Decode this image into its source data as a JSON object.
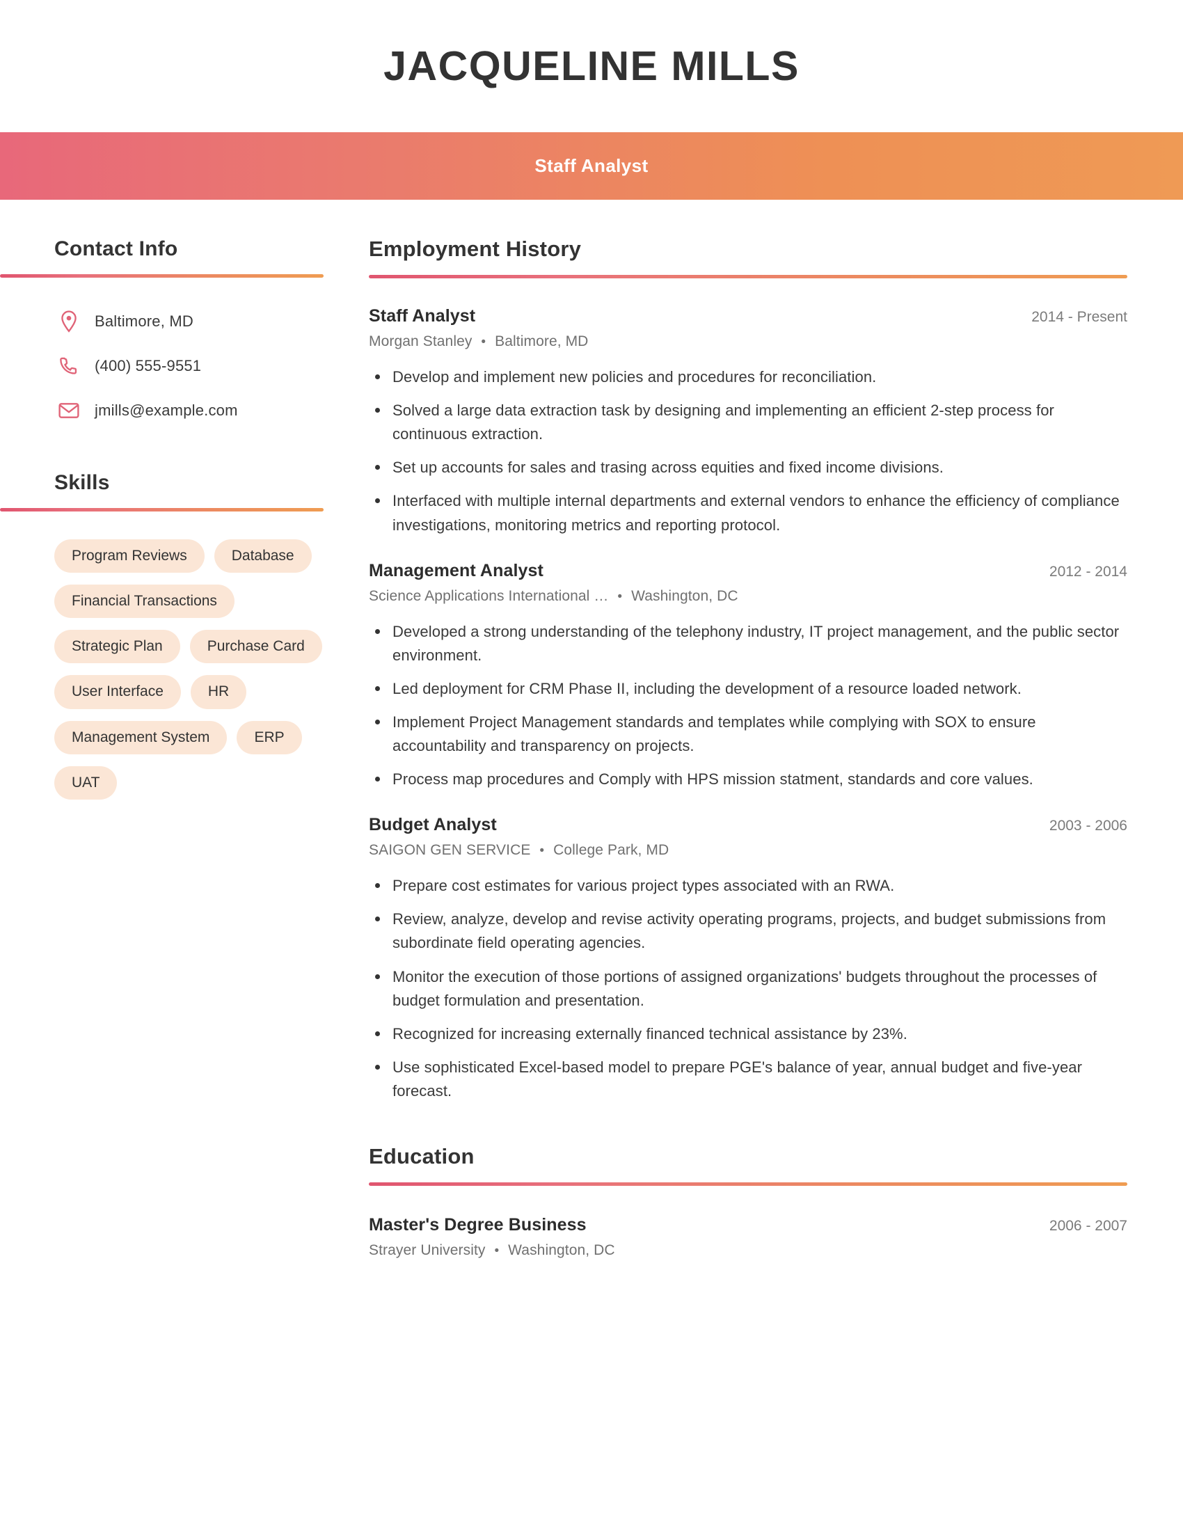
{
  "header": {
    "full_name": "JACQUELINE MILLS",
    "job_title": "Staff Analyst",
    "banner_gradient_start": "#e8687a",
    "banner_gradient_end": "#ef9a55"
  },
  "sidebar": {
    "contact": {
      "heading": "Contact Info",
      "items": [
        {
          "icon": "location-pin-icon",
          "value": "Baltimore, MD"
        },
        {
          "icon": "phone-icon",
          "value": "(400) 555-9551"
        },
        {
          "icon": "envelope-icon",
          "value": "jmills@example.com"
        }
      ]
    },
    "skills": {
      "heading": "Skills",
      "chip_color": "#fbe6d6",
      "items": [
        "Program Reviews",
        "Database",
        "Financial Transactions",
        "Strategic Plan",
        "Purchase Card",
        "User Interface",
        "HR",
        "Management System",
        "ERP",
        "UAT"
      ]
    }
  },
  "main": {
    "employment": {
      "heading": "Employment History",
      "entries": [
        {
          "role": "Staff Analyst",
          "dates": "2014 - Present",
          "company": "Morgan Stanley",
          "location": "Baltimore, MD",
          "bullets": [
            "Develop and implement new policies and procedures for reconciliation.",
            "Solved a large data extraction task by designing and implementing an efficient 2-step process for continuous extraction.",
            "Set up accounts for sales and trasing across equities and fixed income divisions.",
            "Interfaced with multiple internal departments and external vendors to enhance the efficiency of compliance investigations, monitoring metrics and reporting protocol."
          ]
        },
        {
          "role": "Management Analyst",
          "dates": "2012 - 2014",
          "company": "Science Applications International …",
          "location": "Washington, DC",
          "bullets": [
            "Developed a strong understanding of the telephony industry, IT project management, and the public sector environment.",
            "Led deployment for CRM Phase II, including the development of a resource loaded network.",
            "Implement Project Management standards and templates while complying with SOX to ensure accountability and transparency on projects.",
            "Process map procedures and Comply with HPS mission statment, standards and core values."
          ]
        },
        {
          "role": "Budget Analyst",
          "dates": "2003 - 2006",
          "company": "SAIGON GEN SERVICE",
          "location": "College Park, MD",
          "bullets": [
            "Prepare cost estimates for various project types associated with an RWA.",
            "Review, analyze, develop and revise activity operating programs, projects, and budget submissions from subordinate field operating agencies.",
            "Monitor the execution of those portions of assigned organizations' budgets throughout the processes of budget formulation and presentation.",
            "Recognized for increasing externally financed technical assistance by 23%.",
            "Use sophisticated Excel-based model to prepare PGE's balance of year, annual budget and five-year forecast."
          ]
        }
      ]
    },
    "education": {
      "heading": "Education",
      "entries": [
        {
          "degree": "Master's Degree Business",
          "dates": "2006 - 2007",
          "school": "Strayer University",
          "location": "Washington, DC"
        }
      ]
    }
  }
}
